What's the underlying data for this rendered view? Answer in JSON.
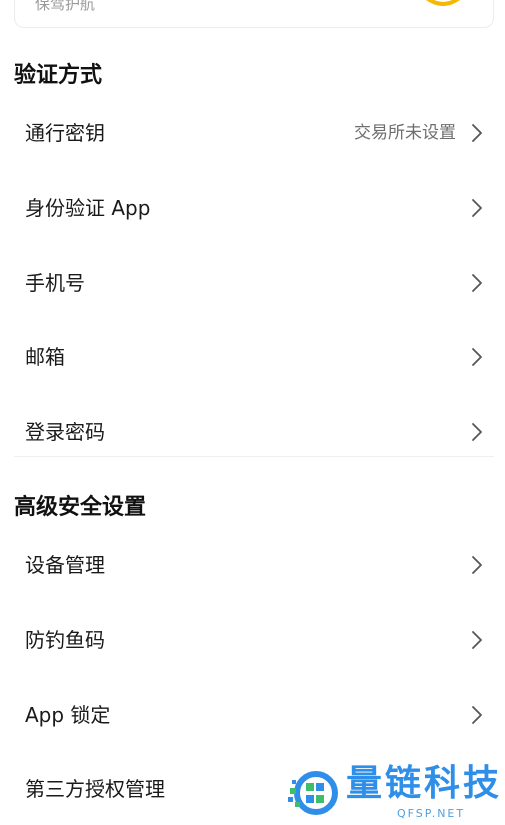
{
  "top_card": {
    "label": "保驾护航"
  },
  "sections": {
    "verification": {
      "title": "验证方式",
      "items": [
        {
          "label": "通行密钥",
          "value": "交易所未设置"
        },
        {
          "label": "身份验证 App",
          "value": ""
        },
        {
          "label": "手机号",
          "value": ""
        },
        {
          "label": "邮箱",
          "value": ""
        },
        {
          "label": "登录密码",
          "value": ""
        }
      ]
    },
    "advanced": {
      "title": "高级安全设置",
      "items": [
        {
          "label": "设备管理"
        },
        {
          "label": "防钓鱼码"
        },
        {
          "label": "App 锁定"
        },
        {
          "label": "第三方授权管理"
        }
      ]
    }
  },
  "watermark": {
    "brand": "量链科技",
    "domain": "QFSP.NET"
  },
  "colors": {
    "accent_yellow": "#f5b800",
    "watermark_blue": "#2f8fe8",
    "watermark_green": "#3bbf6a"
  }
}
